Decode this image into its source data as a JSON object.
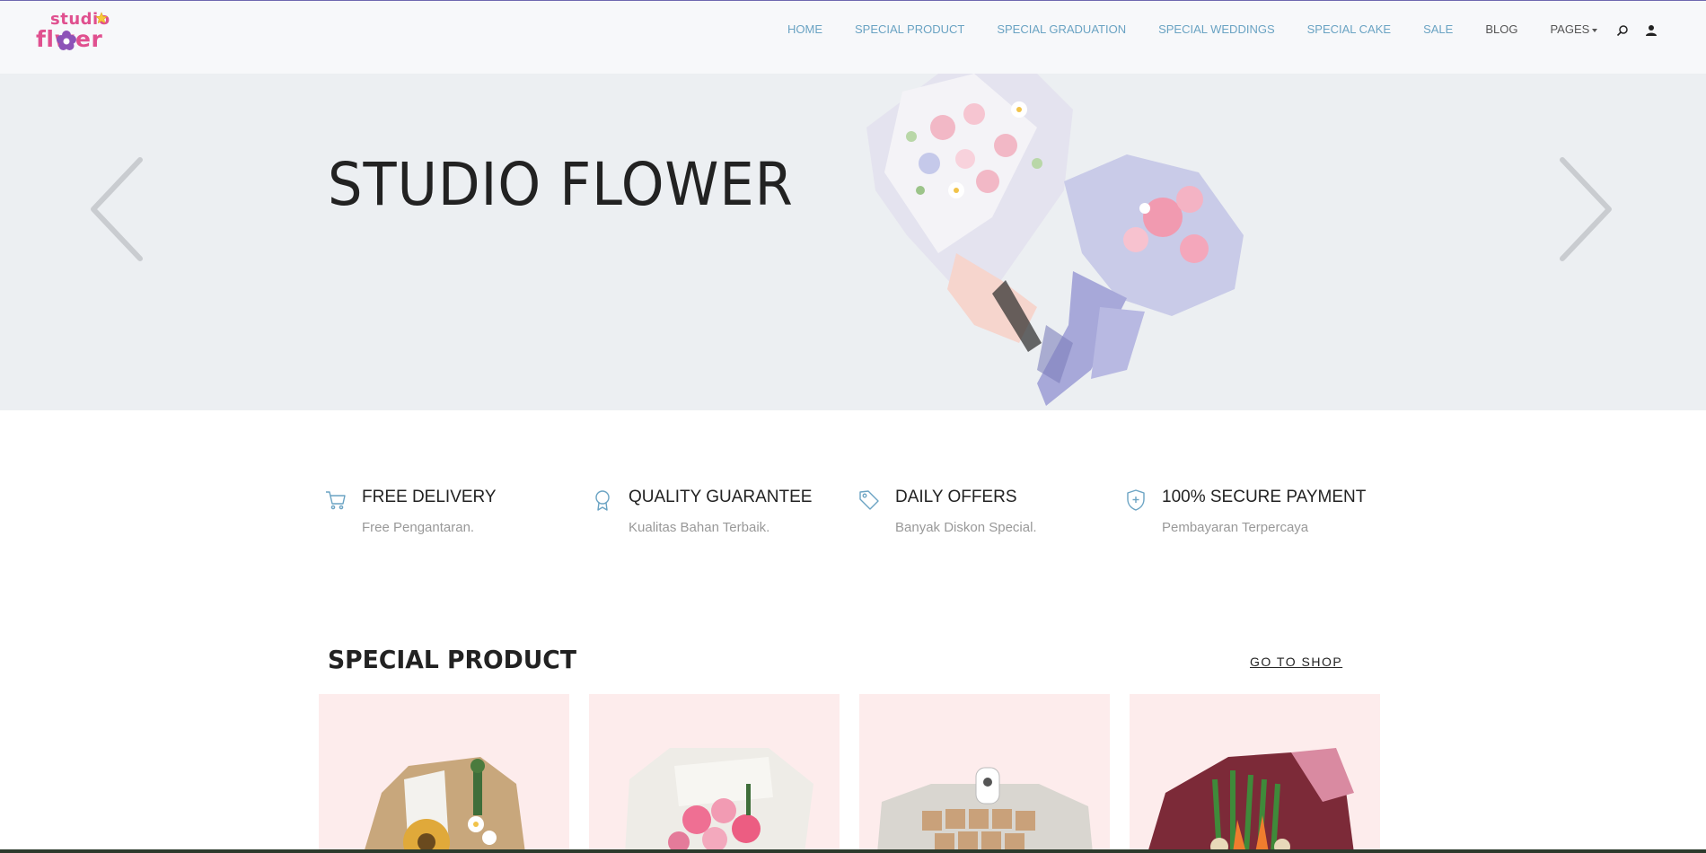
{
  "brand": {
    "logo_line1": "studio",
    "logo_line2": "flwer"
  },
  "nav": {
    "items": [
      {
        "label": "HOME"
      },
      {
        "label": "SPECIAL PRODUCT"
      },
      {
        "label": "SPECIAL GRADUATION"
      },
      {
        "label": "SPECIAL WEDDINGS"
      },
      {
        "label": "SPECIAL CAKE"
      },
      {
        "label": "SALE"
      },
      {
        "label": "BLOG"
      },
      {
        "label": "PAGES"
      }
    ]
  },
  "hero": {
    "title": "STUDIO FLOWER"
  },
  "features": [
    {
      "icon": "cart-icon",
      "title": "FREE DELIVERY",
      "subtitle": "Free Pengantaran."
    },
    {
      "icon": "award-icon",
      "title": "QUALITY GUARANTEE",
      "subtitle": "Kualitas Bahan Terbaik."
    },
    {
      "icon": "tag-icon",
      "title": "DAILY OFFERS",
      "subtitle": "Banyak Diskon Special."
    },
    {
      "icon": "shield-icon",
      "title": "100% SECURE PAYMENT",
      "subtitle": "Pembayaran Terpercaya"
    }
  ],
  "special_product": {
    "title": "SPECIAL PRODUCT",
    "go_to_shop": "GO TO SHOP"
  },
  "colors": {
    "nav_link": "#6aa3c3",
    "logo_pink": "#e0508f",
    "hero_bg": "#eceff2",
    "card_bg": "#fdecec"
  }
}
